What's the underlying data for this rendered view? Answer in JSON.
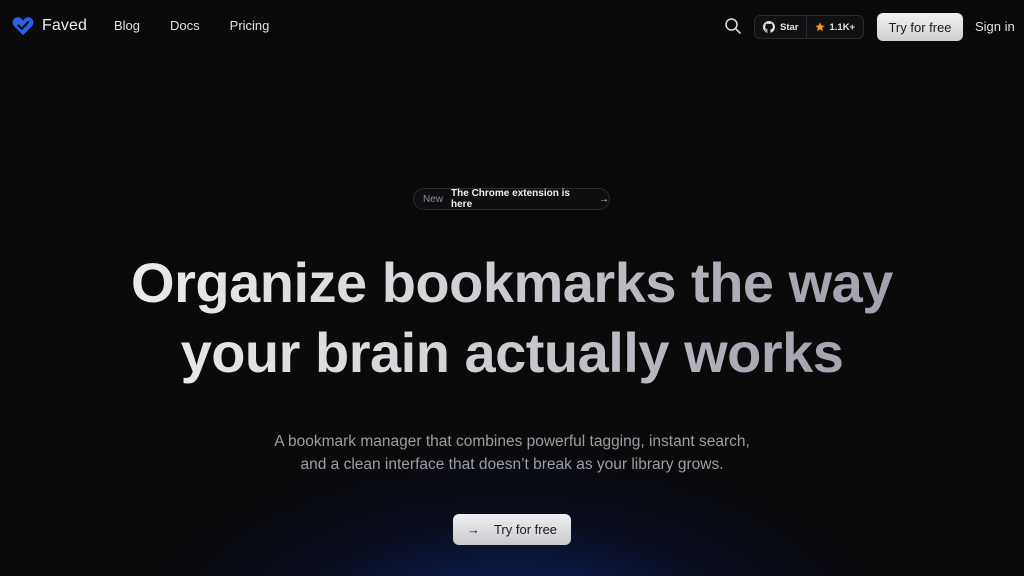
{
  "brand": {
    "name": "Faved",
    "icon": "heart-logo-icon",
    "accent": "#2563eb"
  },
  "nav": {
    "links": [
      "Blog",
      "Docs",
      "Pricing"
    ],
    "search_icon": "search-icon",
    "github": {
      "star_label": "Star",
      "count": "1.1K+"
    },
    "try_label": "Try for free",
    "signin_label": "Sign in"
  },
  "hero": {
    "badge": {
      "tag": "New",
      "text": "The Chrome extension is here",
      "arrow": "→"
    },
    "headline_line1": "Organize bookmarks the way",
    "headline_line2": "your brain actually works",
    "subtitle_line1": "A bookmark manager that combines powerful tagging, instant search,",
    "subtitle_line2": "and a clean interface that doesn’t break as your library grows.",
    "cta_label": "Try for free",
    "cta_arrow": "→"
  }
}
